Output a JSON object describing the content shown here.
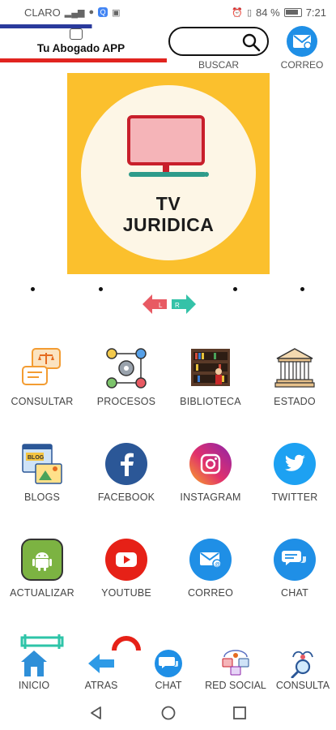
{
  "status_bar": {
    "carrier": "CLARO",
    "battery": "84 %",
    "time": "7:21"
  },
  "header": {
    "app_title": "Tu Abogado APP",
    "search_label": "BUSCAR",
    "mail_label": "CORREO"
  },
  "banner": {
    "line1": "TV",
    "line2": "JURIDICA"
  },
  "carousel": {
    "left_arrow": "L",
    "right_arrow": "R"
  },
  "grid": [
    {
      "label": "CONSULTAR",
      "icon": "consult-scales-icon"
    },
    {
      "label": "PROCESOS",
      "icon": "process-flow-icon"
    },
    {
      "label": "BIBLIOTECA",
      "icon": "library-icon"
    },
    {
      "label": "ESTADO",
      "icon": "courthouse-icon"
    },
    {
      "label": "BLOGS",
      "icon": "blog-icon"
    },
    {
      "label": "FACEBOOK",
      "icon": "facebook-icon"
    },
    {
      "label": "INSTAGRAM",
      "icon": "instagram-icon"
    },
    {
      "label": "TWITTER",
      "icon": "twitter-icon"
    },
    {
      "label": "ACTUALIZAR",
      "icon": "android-icon"
    },
    {
      "label": "YOUTUBE",
      "icon": "youtube-icon"
    },
    {
      "label": "CORREO",
      "icon": "mail-icon"
    },
    {
      "label": "CHAT",
      "icon": "chat-icon"
    }
  ],
  "bottom_nav": [
    {
      "label": "INICIO",
      "icon": "home-icon"
    },
    {
      "label": "ATRAS",
      "icon": "back-arrow-icon"
    },
    {
      "label": "CHAT",
      "icon": "chat-icon"
    },
    {
      "label": "RED SOCIAL",
      "icon": "social-network-icon"
    },
    {
      "label": "CONSULTA",
      "icon": "search-people-icon"
    }
  ],
  "colors": {
    "facebook": "#2b5797",
    "twitter": "#1da1f2",
    "youtube": "#e62117",
    "android": "#7cb342",
    "banner": "#fbc02d",
    "mail": "#1f8fe6"
  }
}
